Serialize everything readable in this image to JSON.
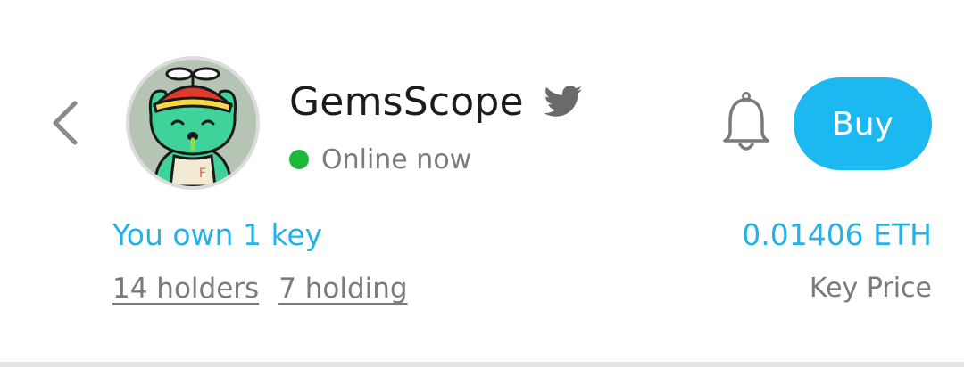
{
  "header": {
    "back_icon": "chevron-left-icon",
    "profile": {
      "name": "GemsScope",
      "social_icon": "twitter-icon",
      "status_text": "Online now",
      "status_color": "#1cb83a"
    },
    "notification_icon": "bell-icon",
    "buy_label": "Buy",
    "accent_color": "#1cb8f2"
  },
  "summary": {
    "ownership_text": "You own 1 key",
    "holders_link": "14 holders",
    "holding_link": "7 holding",
    "key_price_value": "0.01406 ETH",
    "key_price_label": "Key Price"
  }
}
